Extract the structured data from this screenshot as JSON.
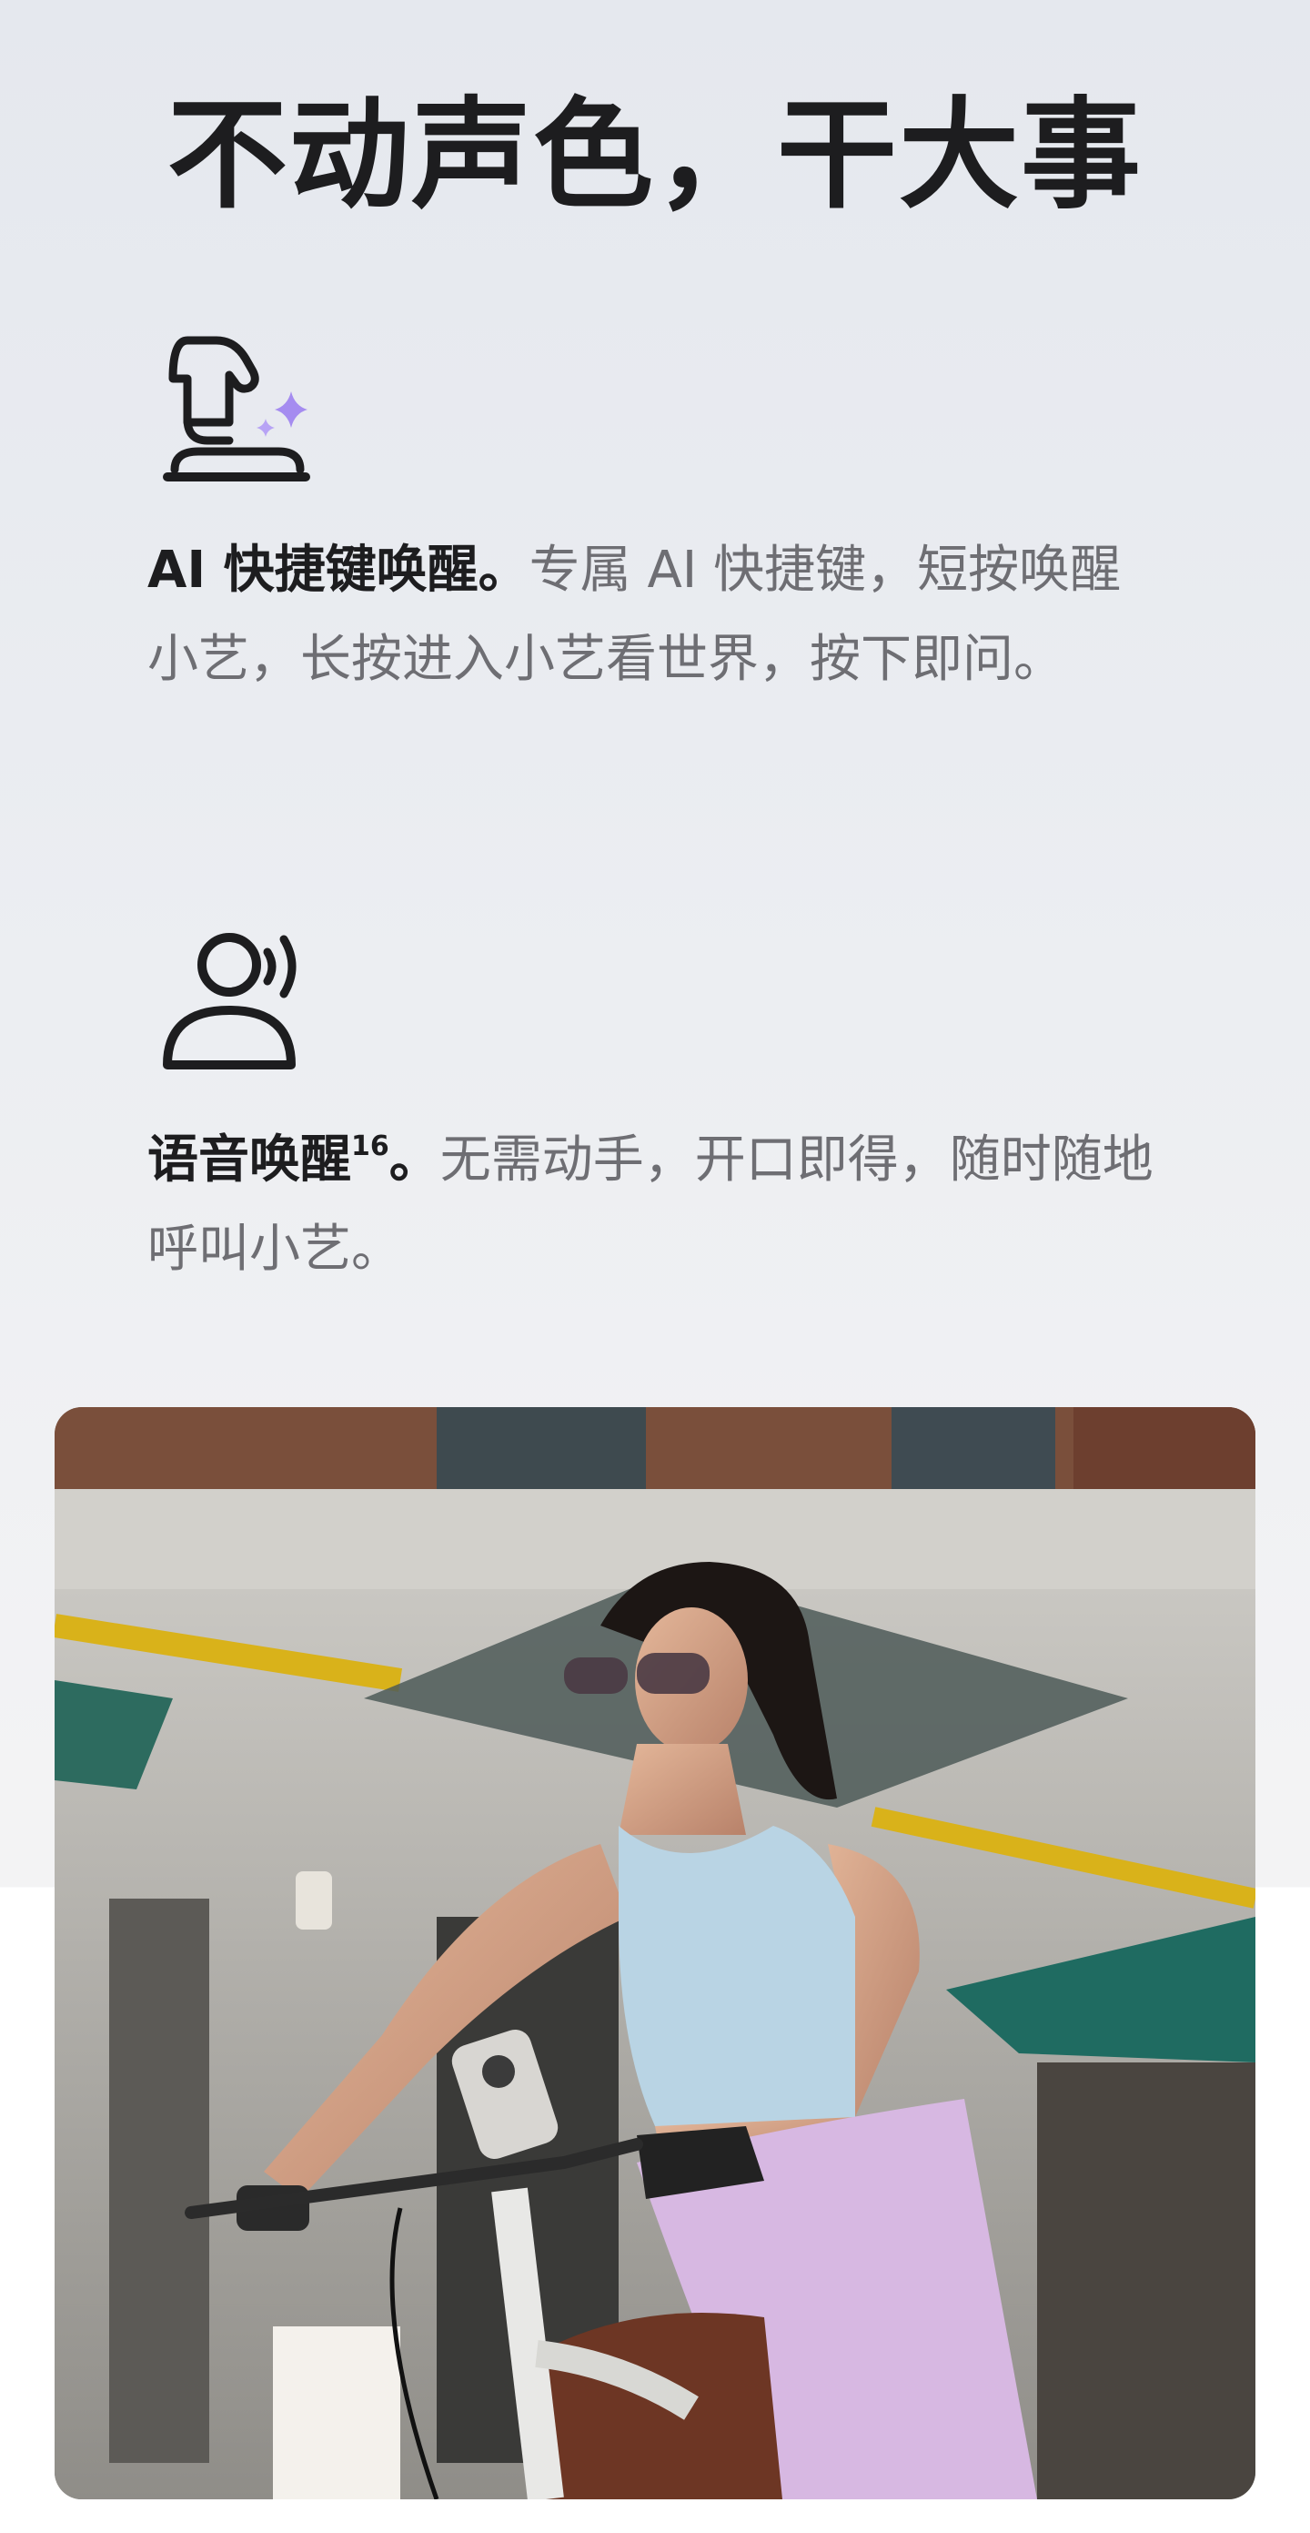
{
  "page": {
    "title": "不动声色，干大事"
  },
  "features": [
    {
      "icon": "ai-shortcut-key-icon",
      "lead": "AI 快捷键唤醒。",
      "sup": "",
      "lead_end": "",
      "body": "专属 AI 快捷键，短按唤醒小艺，长按进入小艺看世界，按下即问。"
    },
    {
      "icon": "voice-wake-icon",
      "lead": "语音唤醒",
      "sup": "16",
      "lead_end": "。",
      "body": "无需动手，开口即得，随时随地呼叫小艺。"
    }
  ],
  "photo": {
    "subject": "woman-riding-bicycle-photo"
  },
  "colors": {
    "heading": "#1d1d1f",
    "body": "#6e6e73",
    "sparkle": "#a58cf0"
  }
}
